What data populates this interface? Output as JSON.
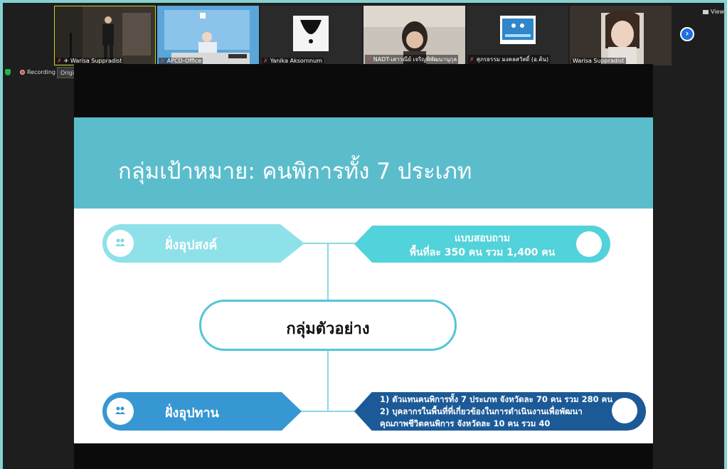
{
  "meeting": {
    "participants": [
      {
        "name": "Warisa Suppradist",
        "muted": true,
        "pinned": true
      },
      {
        "name": "APCD-Office",
        "muted": true
      },
      {
        "name": "Yanika Aksornnum",
        "muted": true
      },
      {
        "name": "NADT-เสาวณีย์ เจริญพิพัฒนานุกุล",
        "muted": true
      },
      {
        "name": "สุภรธรรม มงคลสวัสดิ์ (อ.ต้น)",
        "muted": true
      },
      {
        "name": "Warisa Suppradist",
        "muted": false
      }
    ],
    "view_label": "View",
    "next_icon": "chevron-right-icon",
    "recording_label": "Recording",
    "sound_label": "Original Sound: Off"
  },
  "slide": {
    "title": "กลุ่มเป้าหมาย: คนพิการทั้ง 7 ประเภท",
    "demand_label": "ฝั่งอุปสงค์",
    "demand_info": [
      "แบบสอบถาม",
      "พื้นที่ละ 350 คน รวม 1,400 คน"
    ],
    "center_label": "กลุ่มตัวอย่าง",
    "supply_label": "ฝั่งอุปทาน",
    "supply_info": [
      "1) ตัวแทนคนพิการทั้ง 7 ประเภท จังหวัดละ 70 คน รวม 280 คน",
      "2) บุคลากรในพื้นที่ที่เกี่ยวข้องในการดำเนินงานเพื่อพัฒนา",
      "คุณภาพชีวิตคนพิการ จังหวัดละ 10 คน รวม 40"
    ],
    "colors": {
      "title_band": "#5bbdcc",
      "demand": "#8fe1e9",
      "supply": "#3797d3",
      "supply_info": "#1c5a97"
    }
  }
}
